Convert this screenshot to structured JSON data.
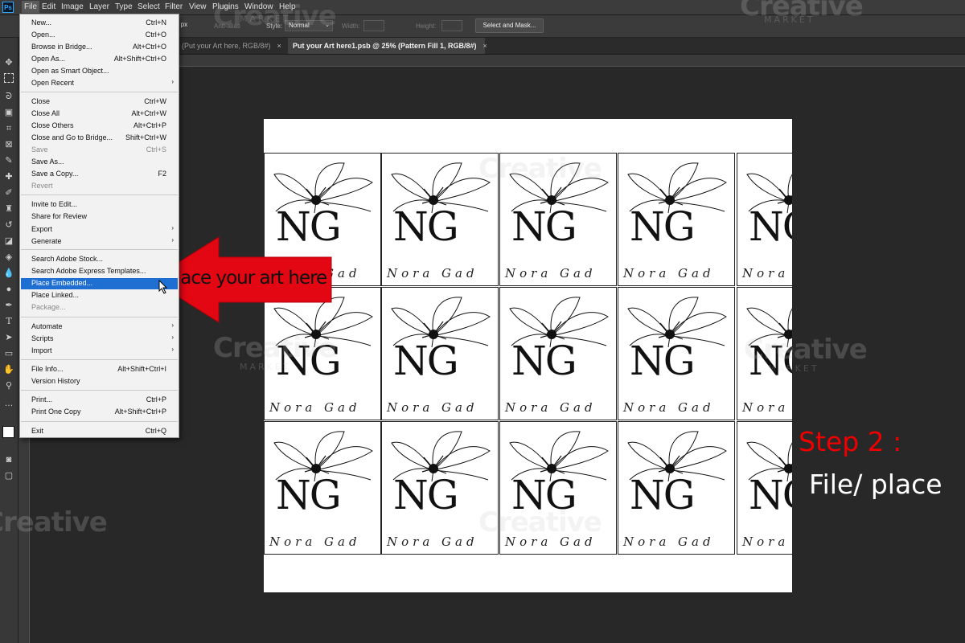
{
  "app": {
    "logo": "Ps"
  },
  "menubar": {
    "items": [
      "File",
      "Edit",
      "Image",
      "Layer",
      "Type",
      "Select",
      "Filter",
      "View",
      "Plugins",
      "Window",
      "Help"
    ]
  },
  "options": {
    "feather_value": "0 px",
    "antialias_label": "Anti-alias",
    "style_label": "Style:",
    "style_value": "Normal",
    "width_label": "Width:",
    "height_label": "Height:",
    "select_mask_label": "Select and Mask..."
  },
  "tabs": [
    {
      "label": "(Put your Art here, RGB/8#)",
      "close": "×"
    },
    {
      "label": "Put your Art here1.psb @ 25% (Pattern Fill 1, RGB/8#)",
      "close": "×"
    }
  ],
  "file_menu": {
    "items": [
      {
        "label": "New...",
        "shortcut": "Ctrl+N"
      },
      {
        "label": "Open...",
        "shortcut": "Ctrl+O"
      },
      {
        "label": "Browse in Bridge...",
        "shortcut": "Alt+Ctrl+O"
      },
      {
        "label": "Open As...",
        "shortcut": "Alt+Shift+Ctrl+O"
      },
      {
        "label": "Open as Smart Object...",
        "shortcut": ""
      },
      {
        "label": "Open Recent",
        "shortcut": "",
        "submenu": "›"
      },
      {
        "label": "Close",
        "shortcut": "Ctrl+W"
      },
      {
        "label": "Close All",
        "shortcut": "Alt+Ctrl+W"
      },
      {
        "label": "Close Others",
        "shortcut": "Alt+Ctrl+P"
      },
      {
        "label": "Close and Go to Bridge...",
        "shortcut": "Shift+Ctrl+W"
      },
      {
        "label": "Save",
        "shortcut": "Ctrl+S"
      },
      {
        "label": "Save As...",
        "shortcut": ""
      },
      {
        "label": "Save a Copy...",
        "shortcut": "F2"
      },
      {
        "label": "Revert",
        "shortcut": ""
      },
      {
        "label": "Invite to Edit...",
        "shortcut": ""
      },
      {
        "label": "Share for Review",
        "shortcut": ""
      },
      {
        "label": "Export",
        "shortcut": "",
        "submenu": "›"
      },
      {
        "label": "Generate",
        "shortcut": "",
        "submenu": "›"
      },
      {
        "label": "Search Adobe Stock...",
        "shortcut": ""
      },
      {
        "label": "Search Adobe Express Templates...",
        "shortcut": ""
      },
      {
        "label": "Place Embedded...",
        "shortcut": ""
      },
      {
        "label": "Place Linked...",
        "shortcut": ""
      },
      {
        "label": "Package...",
        "shortcut": ""
      },
      {
        "label": "Automate",
        "shortcut": "",
        "submenu": "›"
      },
      {
        "label": "Scripts",
        "shortcut": "",
        "submenu": "›"
      },
      {
        "label": "Import",
        "shortcut": "",
        "submenu": "›"
      },
      {
        "label": "File Info...",
        "shortcut": "Alt+Shift+Ctrl+I"
      },
      {
        "label": "Version History",
        "shortcut": ""
      },
      {
        "label": "Print...",
        "shortcut": "Ctrl+P"
      },
      {
        "label": "Print One Copy",
        "shortcut": "Alt+Shift+Ctrl+P"
      },
      {
        "label": "Exit",
        "shortcut": "Ctrl+Q"
      }
    ]
  },
  "pattern_tile": {
    "monogram": "NG",
    "brand": "Nora Gad"
  },
  "annotation": {
    "arrow_label": "Place your art here",
    "step_title": "Step 2 :",
    "step_desc": "File/ place"
  },
  "watermark": {
    "main": "Creative",
    "sub": "MARKET"
  },
  "colors": {
    "accent_arrow": "#e30613",
    "step_title": "#e00000",
    "menu_highlight": "#1f6fd2"
  }
}
